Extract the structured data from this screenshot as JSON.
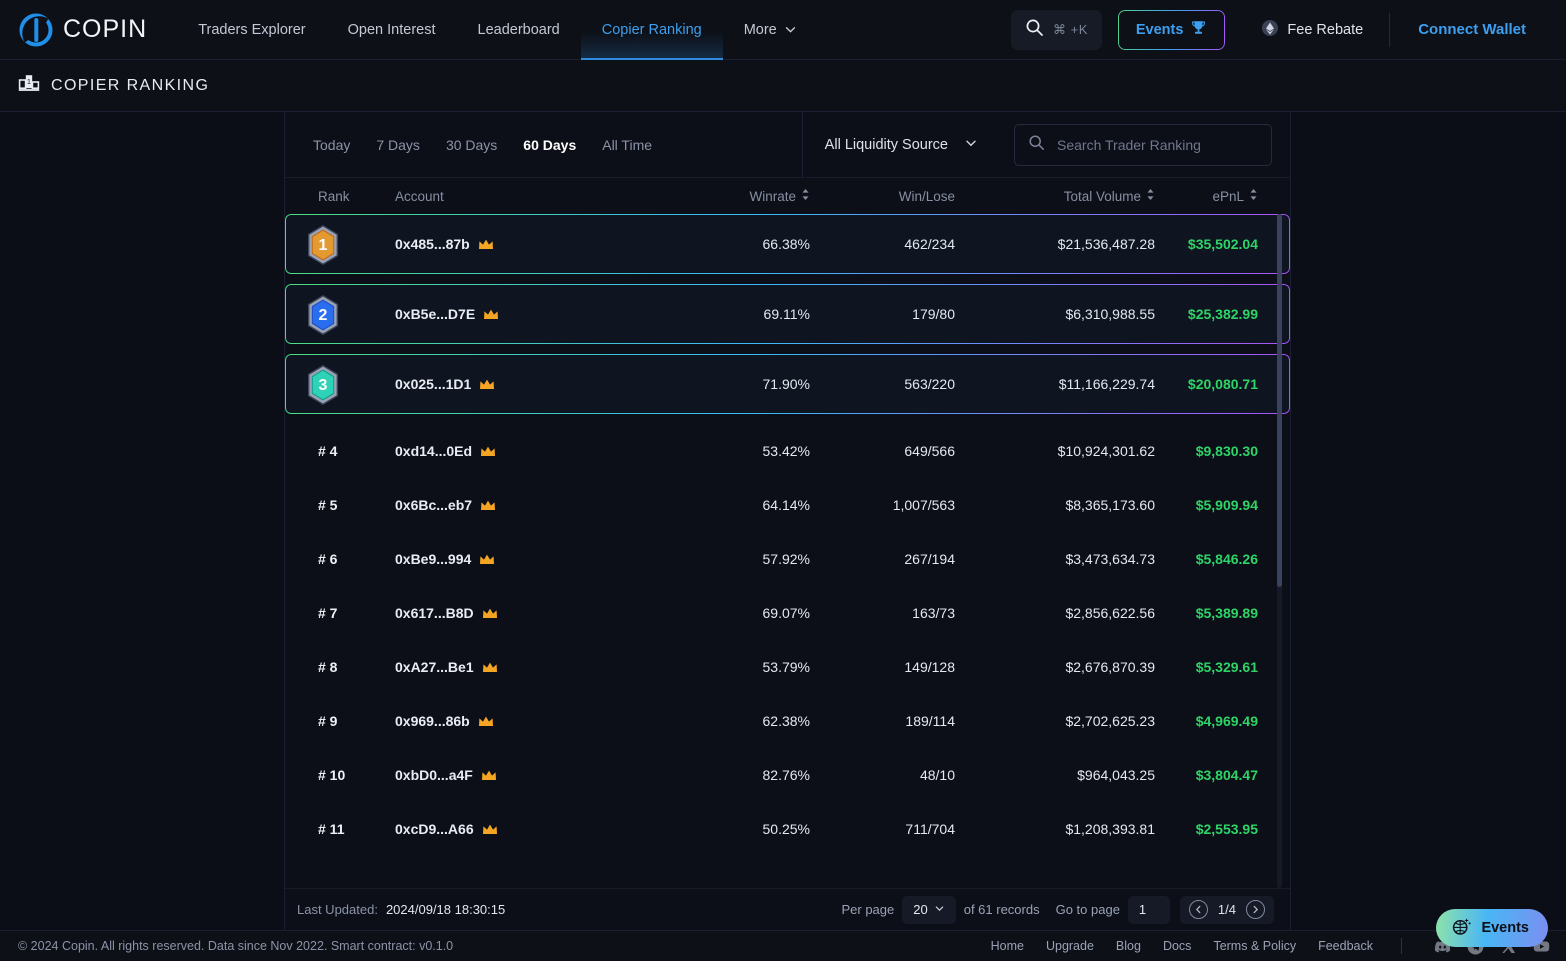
{
  "brand": {
    "name": "COPIN"
  },
  "nav": {
    "links": [
      {
        "label": "Traders Explorer",
        "active": false
      },
      {
        "label": "Open Interest",
        "active": false
      },
      {
        "label": "Leaderboard",
        "active": false
      },
      {
        "label": "Copier Ranking",
        "active": true
      },
      {
        "label": "More",
        "active": false,
        "caret": true
      }
    ],
    "search_shortcut": "⌘ +K",
    "events_label": "Events",
    "fee_rebate_label": "Fee Rebate",
    "connect_wallet_label": "Connect Wallet"
  },
  "page": {
    "title": "COPIER RANKING",
    "icon": "podium-icon"
  },
  "filters": {
    "time_tabs": [
      {
        "label": "Today",
        "active": false
      },
      {
        "label": "7 Days",
        "active": false
      },
      {
        "label": "30 Days",
        "active": false
      },
      {
        "label": "60 Days",
        "active": true
      },
      {
        "label": "All Time",
        "active": false
      }
    ],
    "liquidity_source": "All Liquidity Source",
    "search_placeholder": "Search Trader Ranking",
    "search_value": ""
  },
  "table": {
    "columns": [
      {
        "key": "rank",
        "label": "Rank",
        "sortable": false
      },
      {
        "key": "account",
        "label": "Account",
        "sortable": false
      },
      {
        "key": "winrate",
        "label": "Winrate",
        "sortable": true
      },
      {
        "key": "winlose",
        "label": "Win/Lose",
        "sortable": false
      },
      {
        "key": "volume",
        "label": "Total Volume",
        "sortable": true
      },
      {
        "key": "epnl",
        "label": "ePnL",
        "sortable": true
      }
    ],
    "rows": [
      {
        "rank": "1",
        "rank_display": "1",
        "medal": "gold",
        "account": "0x485...87b",
        "winrate": "66.38%",
        "winlose": "462/234",
        "volume": "$21,536,487.28",
        "epnl": "$35,502.04"
      },
      {
        "rank": "2",
        "rank_display": "2",
        "medal": "silver",
        "account": "0xB5e...D7E",
        "winrate": "69.11%",
        "winlose": "179/80",
        "volume": "$6,310,988.55",
        "epnl": "$25,382.99"
      },
      {
        "rank": "3",
        "rank_display": "3",
        "medal": "bronze",
        "account": "0x025...1D1",
        "winrate": "71.90%",
        "winlose": "563/220",
        "volume": "$11,166,229.74",
        "epnl": "$20,080.71"
      },
      {
        "rank": "4",
        "rank_display": "# 4",
        "medal": null,
        "account": "0xd14...0Ed",
        "winrate": "53.42%",
        "winlose": "649/566",
        "volume": "$10,924,301.62",
        "epnl": "$9,830.30"
      },
      {
        "rank": "5",
        "rank_display": "# 5",
        "medal": null,
        "account": "0x6Bc...eb7",
        "winrate": "64.14%",
        "winlose": "1,007/563",
        "volume": "$8,365,173.60",
        "epnl": "$5,909.94"
      },
      {
        "rank": "6",
        "rank_display": "# 6",
        "medal": null,
        "account": "0xBe9...994",
        "winrate": "57.92%",
        "winlose": "267/194",
        "volume": "$3,473,634.73",
        "epnl": "$5,846.26"
      },
      {
        "rank": "7",
        "rank_display": "# 7",
        "medal": null,
        "account": "0x617...B8D",
        "winrate": "69.07%",
        "winlose": "163/73",
        "volume": "$2,856,622.56",
        "epnl": "$5,389.89"
      },
      {
        "rank": "8",
        "rank_display": "# 8",
        "medal": null,
        "account": "0xA27...Be1",
        "winrate": "53.79%",
        "winlose": "149/128",
        "volume": "$2,676,870.39",
        "epnl": "$5,329.61"
      },
      {
        "rank": "9",
        "rank_display": "# 9",
        "medal": null,
        "account": "0x969...86b",
        "winrate": "62.38%",
        "winlose": "189/114",
        "volume": "$2,702,625.23",
        "epnl": "$4,969.49"
      },
      {
        "rank": "10",
        "rank_display": "# 10",
        "medal": null,
        "account": "0xbD0...a4F",
        "winrate": "82.76%",
        "winlose": "48/10",
        "volume": "$964,043.25",
        "epnl": "$3,804.47"
      },
      {
        "rank": "11",
        "rank_display": "# 11",
        "medal": null,
        "account": "0xcD9...A66",
        "winrate": "50.25%",
        "winlose": "711/704",
        "volume": "$1,208,393.81",
        "epnl": "$2,553.95"
      }
    ]
  },
  "table_footer": {
    "last_updated_label": "Last Updated:",
    "last_updated_value": "2024/09/18 18:30:15",
    "per_page_label": "Per page",
    "per_page_value": "20",
    "records_label": "of 61 records",
    "go_to_page_label": "Go to page",
    "go_to_page_value": "1",
    "page_indicator": "1/4"
  },
  "footer": {
    "copyright": "© 2024 Copin. All rights reserved. Data since Nov 2022. Smart contract: v0.1.0",
    "links": [
      {
        "label": "Home"
      },
      {
        "label": "Upgrade"
      },
      {
        "label": "Blog"
      },
      {
        "label": "Docs"
      },
      {
        "label": "Terms & Policy"
      },
      {
        "label": "Feedback"
      }
    ],
    "socials": [
      "discord-icon",
      "telegram-icon",
      "x-twitter-icon",
      "youtube-icon"
    ]
  },
  "floating": {
    "events_label": "Events"
  },
  "colors": {
    "accent_blue": "#3c9ff0",
    "positive_green": "#2fd467",
    "background": "#0b0e17",
    "panel": "#0c0f18",
    "crown_gold": "#f5a524"
  }
}
